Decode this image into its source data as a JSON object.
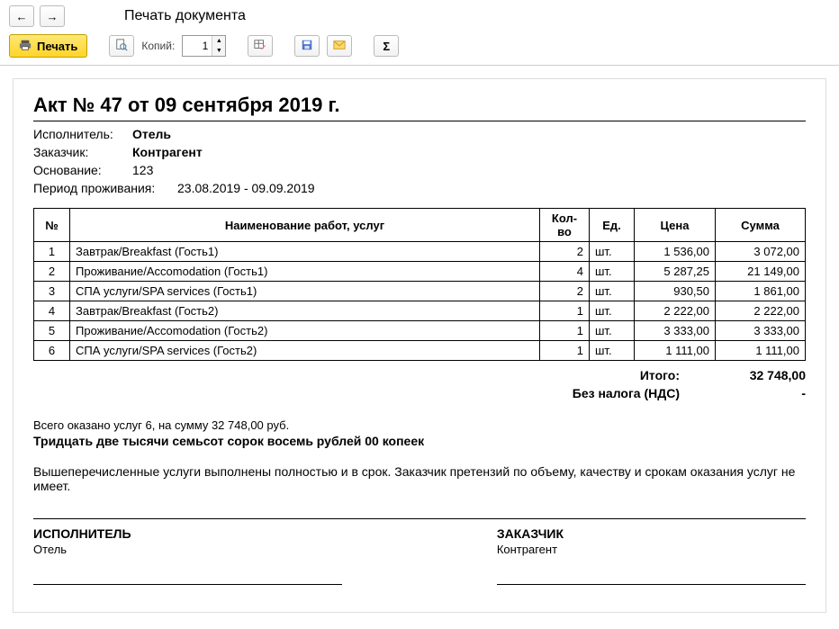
{
  "window": {
    "title": "Печать документа"
  },
  "toolbar": {
    "print_label": "Печать",
    "copies_label": "Копий:",
    "copies_value": "1"
  },
  "doc": {
    "heading": "Акт № 47 от 09 сентября 2019 г.",
    "executor_label": "Исполнитель:",
    "executor_value": "Отель",
    "customer_label": "Заказчик:",
    "customer_value": "Контрагент",
    "basis_label": "Основание:",
    "basis_value": "123",
    "period_label": "Период проживания:",
    "period_value": "23.08.2019 - 09.09.2019"
  },
  "table": {
    "headers": {
      "num": "№",
      "name": "Наименование работ, услуг",
      "qty": "Кол-во",
      "unit": "Ед.",
      "price": "Цена",
      "sum": "Сумма"
    },
    "rows": [
      {
        "num": "1",
        "name": "Завтрак/Breakfast (Гость1)",
        "qty": "2",
        "unit": "шт.",
        "price": "1 536,00",
        "sum": "3 072,00"
      },
      {
        "num": "2",
        "name": "Проживание/Accomodation (Гость1)",
        "qty": "4",
        "unit": "шт.",
        "price": "5 287,25",
        "sum": "21 149,00"
      },
      {
        "num": "3",
        "name": "СПА услуги/SPA services (Гость1)",
        "qty": "2",
        "unit": "шт.",
        "price": "930,50",
        "sum": "1 861,00"
      },
      {
        "num": "4",
        "name": "Завтрак/Breakfast (Гость2)",
        "qty": "1",
        "unit": "шт.",
        "price": "2 222,00",
        "sum": "2 222,00"
      },
      {
        "num": "5",
        "name": "Проживание/Accomodation (Гость2)",
        "qty": "1",
        "unit": "шт.",
        "price": "3 333,00",
        "sum": "3 333,00"
      },
      {
        "num": "6",
        "name": "СПА услуги/SPA services (Гость2)",
        "qty": "1",
        "unit": "шт.",
        "price": "1 111,00",
        "sum": "1 111,00"
      }
    ]
  },
  "totals": {
    "total_label": "Итого:",
    "total_value": "32 748,00",
    "tax_label": "Без налога (НДС)",
    "tax_value": "-"
  },
  "summary": {
    "line": "Всего оказано услуг 6, на сумму 32 748,00 руб.",
    "words": "Тридцать две тысячи семьсот сорок восемь рублей 00 копеек"
  },
  "note": "Вышеперечисленные услуги выполнены полностью и в срок. Заказчик претензий по объему, качеству и срокам оказания услуг не имеет.",
  "sign": {
    "executor_role": "ИСПОЛНИТЕЛЬ",
    "executor_name": "Отель",
    "customer_role": "ЗАКАЗЧИК",
    "customer_name": "Контрагент"
  }
}
